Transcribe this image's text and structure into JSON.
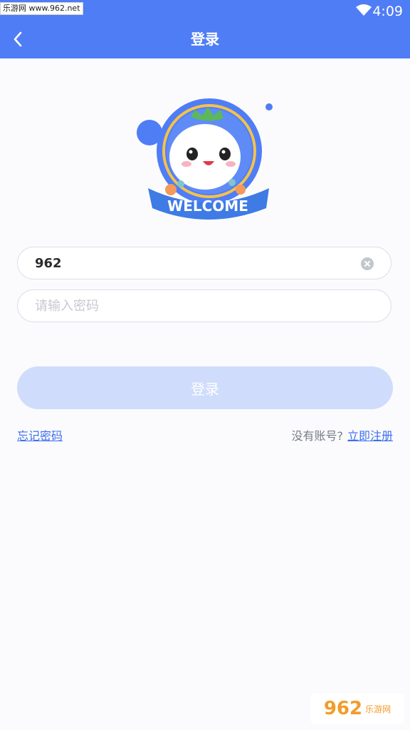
{
  "status_bar": {
    "time": "4:09",
    "watermark_badge": "乐游网 www.962.net"
  },
  "header": {
    "title": "登录",
    "back_icon": "chevron-left-icon",
    "bar_color": "#4f7df6"
  },
  "logo": {
    "banner_text": "WELCOME"
  },
  "form": {
    "username_value": "962",
    "username_placeholder": "",
    "password_value": "",
    "password_placeholder": "请输入密码",
    "login_label": "登录"
  },
  "links": {
    "forgot_password": "忘记密码",
    "no_account": "没有账号?",
    "register": "立即注册"
  },
  "watermark": {
    "text": "962",
    "sub": "乐游网"
  }
}
